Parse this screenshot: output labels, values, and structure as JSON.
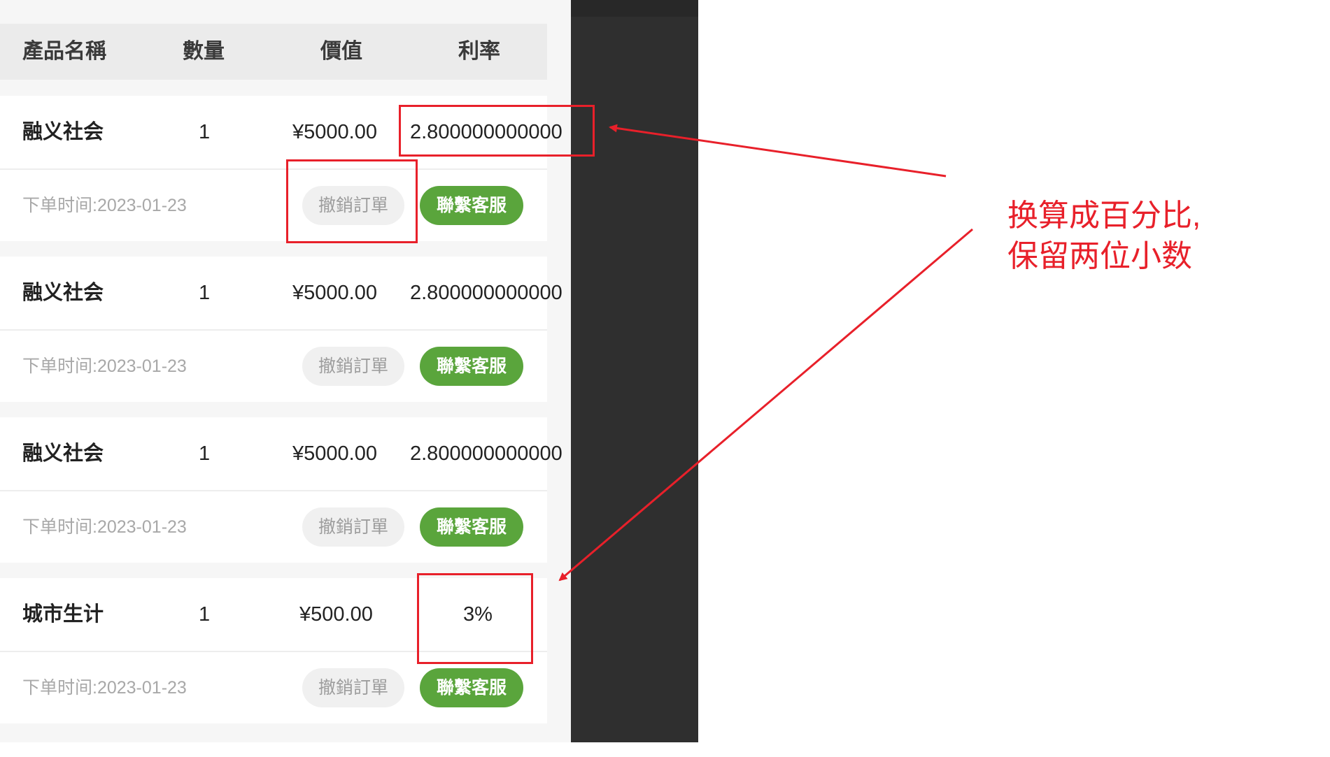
{
  "table": {
    "headers": {
      "name": "產品名稱",
      "quantity": "數量",
      "value": "價值",
      "rate": "利率"
    },
    "rows": [
      {
        "name": "融义社会",
        "quantity": "1",
        "value": "¥5000.00",
        "rate": "2.800000000000",
        "order_time": "下单时间:2023-01-23"
      },
      {
        "name": "融义社会",
        "quantity": "1",
        "value": "¥5000.00",
        "rate": "2.800000000000",
        "order_time": "下单时间:2023-01-23"
      },
      {
        "name": "融义社会",
        "quantity": "1",
        "value": "¥5000.00",
        "rate": "2.800000000000",
        "order_time": "下单时间:2023-01-23"
      },
      {
        "name": "城市生计",
        "quantity": "1",
        "value": "¥500.00",
        "rate": "3%",
        "order_time": "下单时间:2023-01-23"
      }
    ]
  },
  "buttons": {
    "cancel_label": "撤銷訂單",
    "contact_label": "聯繫客服"
  },
  "annotation": {
    "line1": "换算成百分比,",
    "line2": "保留两位小数"
  },
  "colors": {
    "accent_green": "#5aa53c",
    "annotation_red": "#e8202a",
    "dark_panel": "#2f2f2f"
  }
}
